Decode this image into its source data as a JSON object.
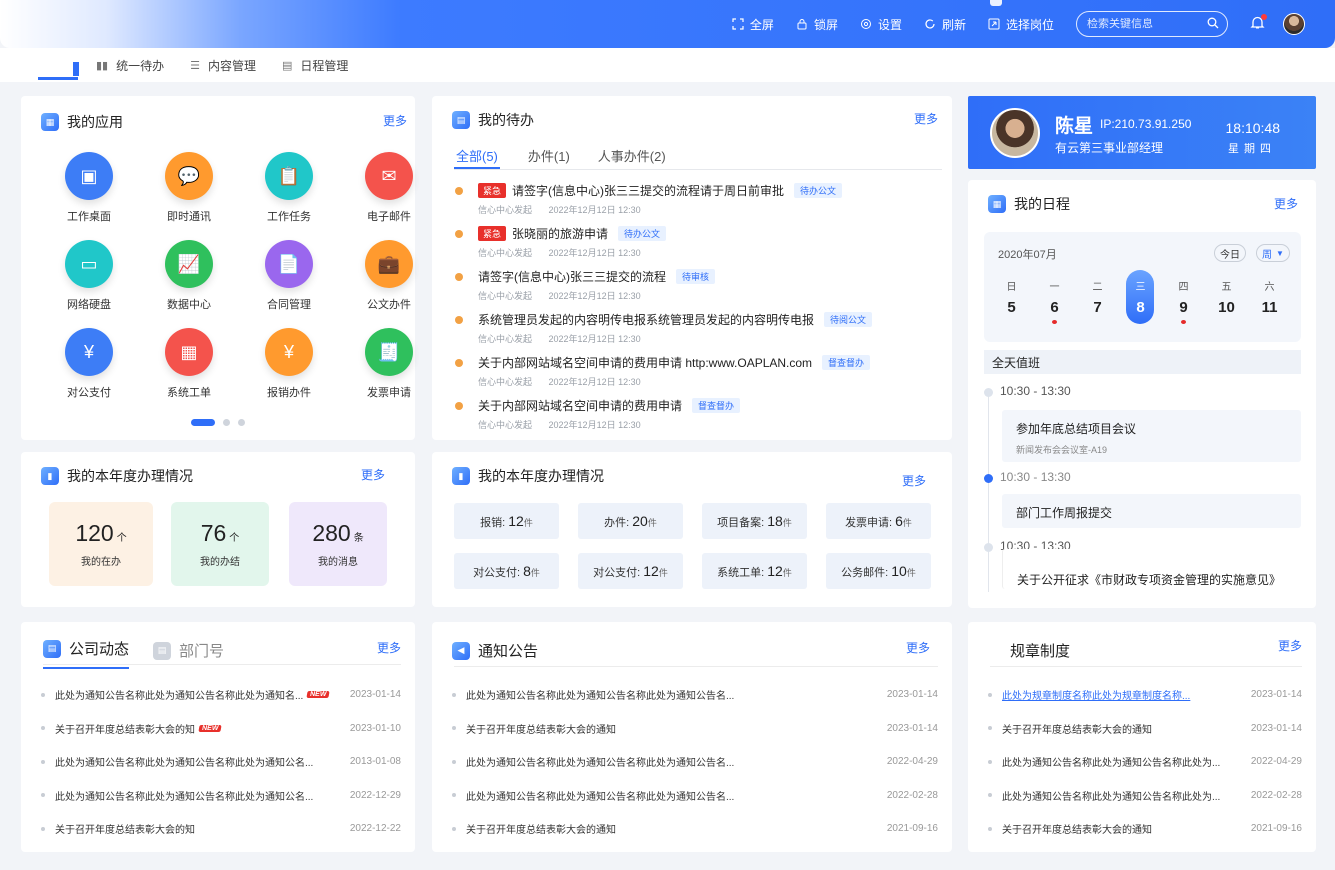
{
  "header": {
    "tools": [
      {
        "icon": "fullscreen-icon",
        "label": "全屏"
      },
      {
        "icon": "lock-icon",
        "label": "锁屏"
      },
      {
        "icon": "gear-icon",
        "label": "设置"
      },
      {
        "icon": "refresh-icon",
        "label": "刷新"
      },
      {
        "icon": "switch-role-icon",
        "label": "选择岗位"
      }
    ],
    "search_placeholder": "检索关键信息"
  },
  "tabs": [
    {
      "icon": "unified-todo-icon",
      "label": "统一待办"
    },
    {
      "icon": "list-icon",
      "label": "内容管理"
    },
    {
      "icon": "schedule-icon",
      "label": "日程管理"
    }
  ],
  "my_apps": {
    "title": "我的应用",
    "more": "更多",
    "apps": [
      {
        "label": "工作桌面",
        "icon": "desktop-icon",
        "color": "#3d7df6"
      },
      {
        "label": "即时通讯",
        "icon": "chat-icon",
        "color": "#ff9a2e"
      },
      {
        "label": "工作任务",
        "icon": "clipboard-icon",
        "color": "#20c7c9"
      },
      {
        "label": "电子邮件",
        "icon": "mail-icon",
        "color": "#f4534c"
      },
      {
        "label": "网络硬盘",
        "icon": "disk-icon",
        "color": "#20c7c9"
      },
      {
        "label": "数据中心",
        "icon": "chart-icon",
        "color": "#2fc05d"
      },
      {
        "label": "合同管理",
        "icon": "contract-icon",
        "color": "#9a67ee"
      },
      {
        "label": "公文办件",
        "icon": "briefcase-icon",
        "color": "#ff9a2e"
      },
      {
        "label": "对公支付",
        "icon": "payment-icon",
        "color": "#3d7df6"
      },
      {
        "label": "系统工单",
        "icon": "ticket-icon",
        "color": "#f4534c"
      },
      {
        "label": "报销办件",
        "icon": "reimburse-icon",
        "color": "#ff9a2e"
      },
      {
        "label": "发票申请",
        "icon": "invoice-icon",
        "color": "#2fc05d"
      }
    ]
  },
  "my_todo": {
    "title": "我的待办",
    "more": "更多",
    "tabs": [
      "全部(5)",
      "办件(1)",
      "人事办件(2)"
    ],
    "items": [
      {
        "urgent": "紧急",
        "title": "请签字(信息中心)张三三提交的流程请于周日前审批",
        "tag": "待办公文",
        "source": "信心中心发起",
        "time": "2022年12月12日 12:30"
      },
      {
        "urgent": "紧急",
        "title": "张晓丽的旅游申请",
        "tag": "待办公文",
        "source": "信心中心发起",
        "time": "2022年12月12日 12:30"
      },
      {
        "urgent": "",
        "title": "请签字(信息中心)张三三提交的流程",
        "tag": "待审核",
        "source": "信心中心发起",
        "time": "2022年12月12日 12:30"
      },
      {
        "urgent": "",
        "title": "系统管理员发起的内容明传电报系统管理员发起的内容明传电报",
        "tag": "待阅公文",
        "source": "信心中心发起",
        "time": "2022年12月12日 12:30"
      },
      {
        "urgent": "",
        "title": "关于内部网站域名空间申请的费用申请 http:www.OAPLAN.com",
        "tag": "督查督办",
        "source": "信心中心发起",
        "time": "2022年12月12日 12:30"
      },
      {
        "urgent": "",
        "title": "关于内部网站域名空间申请的费用申请",
        "tag": "督查督办",
        "source": "信心中心发起",
        "time": "2022年12月12日 12:30"
      }
    ]
  },
  "profile": {
    "name": "陈星",
    "ip": "IP:210.73.91.250",
    "dept": "有云第三事业部经理",
    "time": "18:10:48",
    "weekday": "星期四"
  },
  "schedule": {
    "title": "我的日程",
    "more": "更多",
    "month": "2020年07月",
    "today_btn": "今日",
    "view_btn": "周",
    "days": [
      {
        "w": "日",
        "d": "5",
        "mark": false,
        "on": false
      },
      {
        "w": "一",
        "d": "6",
        "mark": true,
        "on": false
      },
      {
        "w": "二",
        "d": "7",
        "mark": false,
        "on": false
      },
      {
        "w": "三",
        "d": "8",
        "mark": false,
        "on": true
      },
      {
        "w": "四",
        "d": "9",
        "mark": true,
        "on": false
      },
      {
        "w": "五",
        "d": "10",
        "mark": false,
        "on": false
      },
      {
        "w": "六",
        "d": "11",
        "mark": false,
        "on": false
      }
    ],
    "allday": "全天值班",
    "events": [
      {
        "time": "10:30 - 13:30",
        "title": "参加年底总结项目会议",
        "place": "新闻发布会会议室-A19",
        "active": false
      },
      {
        "time": "10:30 - 13:30",
        "title": "部门工作周报提交",
        "place": "",
        "active": true
      },
      {
        "time": "10:30 - 13:30",
        "title": "关于公开征求《市财政专项资金管理的实施意见》",
        "place": "",
        "active": false
      }
    ]
  },
  "year_stats": {
    "title": "我的本年度办理情况",
    "more": "更多",
    "items": [
      {
        "value": "120",
        "unit": "个",
        "label": "我的在办",
        "color": "#fdf1e4"
      },
      {
        "value": "76",
        "unit": "个",
        "label": "我的办结",
        "color": "#e2f6ec"
      },
      {
        "value": "280",
        "unit": "条",
        "label": "我的消息",
        "color": "#efe8fb"
      }
    ]
  },
  "year_detail": {
    "title": "我的本年度办理情况",
    "more": "更多",
    "items": [
      {
        "label": "报销:",
        "value": "12",
        "unit": "件"
      },
      {
        "label": "办件:",
        "value": "20",
        "unit": "件"
      },
      {
        "label": "项目备案:",
        "value": "18",
        "unit": "件"
      },
      {
        "label": "发票申请:",
        "value": "6",
        "unit": "件"
      },
      {
        "label": "对公支付:",
        "value": "8",
        "unit": "件"
      },
      {
        "label": "对公支付:",
        "value": "12",
        "unit": "件"
      },
      {
        "label": "系统工单:",
        "value": "12",
        "unit": "件"
      },
      {
        "label": "公务邮件:",
        "value": "10",
        "unit": "件"
      }
    ]
  },
  "company_news": {
    "tab_active": "公司动态",
    "tab_other": "部门号",
    "more": "更多",
    "items": [
      {
        "title": "此处为通知公告名称此处为通知公告名称此处为通知名...",
        "new": true,
        "date": "2023-01-14"
      },
      {
        "title": "关于召开年度总结表彰大会的知",
        "new": true,
        "date": "2023-01-10"
      },
      {
        "title": "此处为通知公告名称此处为通知公告名称此处为通知公名...",
        "new": false,
        "date": "2013-01-08"
      },
      {
        "title": "此处为通知公告名称此处为通知公告名称此处为通知公名...",
        "new": false,
        "date": "2022-12-29"
      },
      {
        "title": "关于召开年度总结表彰大会的知",
        "new": false,
        "date": "2022-12-22"
      }
    ],
    "new_label": "NEW"
  },
  "notices": {
    "title": "通知公告",
    "more": "更多",
    "items": [
      {
        "title": "此处为通知公告名称此处为通知公告名称此处为通知公告名...",
        "date": "2023-01-14"
      },
      {
        "title": "关于召开年度总结表彰大会的通知",
        "date": "2023-01-14"
      },
      {
        "title": "此处为通知公告名称此处为通知公告名称此处为通知公告名...",
        "date": "2022-04-29"
      },
      {
        "title": "此处为通知公告名称此处为通知公告名称此处为通知公告名...",
        "date": "2022-02-28"
      },
      {
        "title": "关于召开年度总结表彰大会的通知",
        "date": "2021-09-16"
      }
    ]
  },
  "rules": {
    "title": "规章制度",
    "more": "更多",
    "items": [
      {
        "title": "此处为规章制度名称此处为规章制度名称...",
        "date": "2023-01-14",
        "link": true
      },
      {
        "title": "关于召开年度总结表彰大会的通知",
        "date": "2023-01-14",
        "link": false
      },
      {
        "title": "此处为通知公告名称此处为通知公告名称此处为...",
        "date": "2022-04-29",
        "link": false
      },
      {
        "title": "此处为通知公告名称此处为通知公告名称此处为...",
        "date": "2022-02-28",
        "link": false
      },
      {
        "title": "关于召开年度总结表彰大会的通知",
        "date": "2021-09-16",
        "link": false
      }
    ]
  }
}
